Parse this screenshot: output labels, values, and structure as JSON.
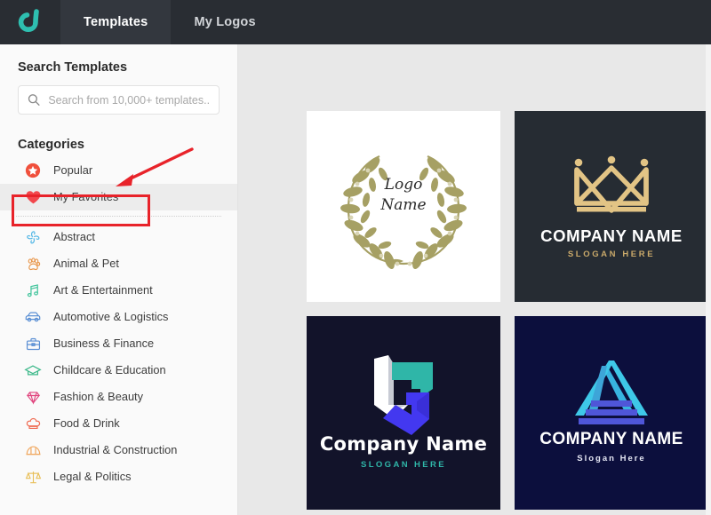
{
  "app": {
    "brand_icon": "droplet-logo-icon",
    "brand_color": "#2ebfb0"
  },
  "topbar": {
    "tabs": [
      {
        "label": "Templates",
        "active": true
      },
      {
        "label": "My Logos",
        "active": false
      }
    ]
  },
  "sidebar": {
    "search_title": "Search Templates",
    "search": {
      "placeholder": "Search from 10,000+ templates...",
      "value": "",
      "icon": "search-icon"
    },
    "categories_title": "Categories",
    "pinned": [
      {
        "label": "Popular",
        "icon": "star-circle-icon",
        "color": "#f0503c",
        "selected": false
      },
      {
        "label": "My Favorites",
        "icon": "heart-icon",
        "color": "#f2474c",
        "selected": true
      }
    ],
    "items": [
      {
        "label": "Abstract",
        "icon": "abstract-icon",
        "color": "#56b8e6"
      },
      {
        "label": "Animal & Pet",
        "icon": "paw-icon",
        "color": "#e8964a"
      },
      {
        "label": "Art & Entertainment",
        "icon": "music-note-icon",
        "color": "#3ec39a"
      },
      {
        "label": "Automotive & Logistics",
        "icon": "car-icon",
        "color": "#5a8fd4"
      },
      {
        "label": "Business & Finance",
        "icon": "briefcase-icon",
        "color": "#5a8fd4"
      },
      {
        "label": "Childcare & Education",
        "icon": "graduation-cap-icon",
        "color": "#3fb98b"
      },
      {
        "label": "Fashion & Beauty",
        "icon": "diamond-icon",
        "color": "#e0457e"
      },
      {
        "label": "Food & Drink",
        "icon": "chef-hat-icon",
        "color": "#ef6b52"
      },
      {
        "label": "Industrial & Construction",
        "icon": "hard-hat-icon",
        "color": "#f0a860"
      },
      {
        "label": "Legal & Politics",
        "icon": "scales-icon",
        "color": "#e8bf58"
      }
    ]
  },
  "templates": [
    {
      "id": "wreath",
      "style": "laurel-wreath",
      "background": "#ffffff",
      "line1": "Logo",
      "line2": "Name",
      "accent": "#a6a064"
    },
    {
      "id": "crown",
      "style": "crown-emblem",
      "background": "#262c33",
      "name": "COMPANY NAME",
      "slogan": "SLOGAN HERE",
      "accent": "#e2c485"
    },
    {
      "id": "abstract",
      "style": "geometric-arrow",
      "background": "#12132a",
      "name": "Company Name",
      "slogan": "SLOGAN HERE",
      "accent": "#2fb6a8",
      "accent2": "#4338f0"
    },
    {
      "id": "triangle",
      "style": "triangle-pyramid",
      "background": "#0c0f3d",
      "name": "COMPANY NAME",
      "slogan": "Slogan Here",
      "accent": "#3ec8e8",
      "accent2": "#4f56d8"
    }
  ],
  "annotations": {
    "highlight_color": "#e8232a",
    "highlight_target": "My Favorites",
    "arrow": "points-to-my-favorites"
  }
}
